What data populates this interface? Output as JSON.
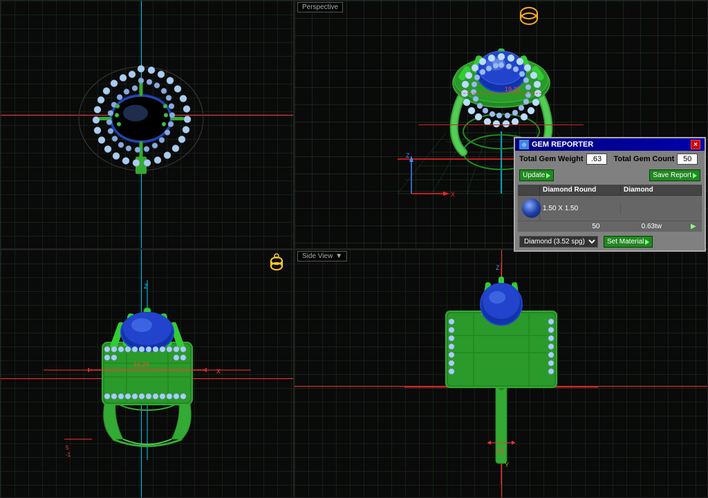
{
  "viewports": {
    "top_left": {
      "label": ""
    },
    "top_right": {
      "label": "Perspective"
    },
    "bottom_left": {
      "label": ""
    },
    "bottom_right": {
      "label": "Side View"
    }
  },
  "gem_reporter": {
    "title": "GEM REPORTER",
    "close_label": "×",
    "weight_label": "Total Gem Weight",
    "weight_value": ".63",
    "count_label": "Total Gem Count",
    "count_value": "50",
    "update_label": "Update",
    "save_label": "Save Report",
    "table_headers": [
      "",
      "Diamond Round",
      "Diamond"
    ],
    "table_row1": [
      "",
      "1.50 X 1.50",
      "50",
      "0.63tw",
      "▶"
    ],
    "material_label": "Diamond",
    "material_spg": "(3.52 spg)",
    "set_material_label": "Set Material"
  }
}
